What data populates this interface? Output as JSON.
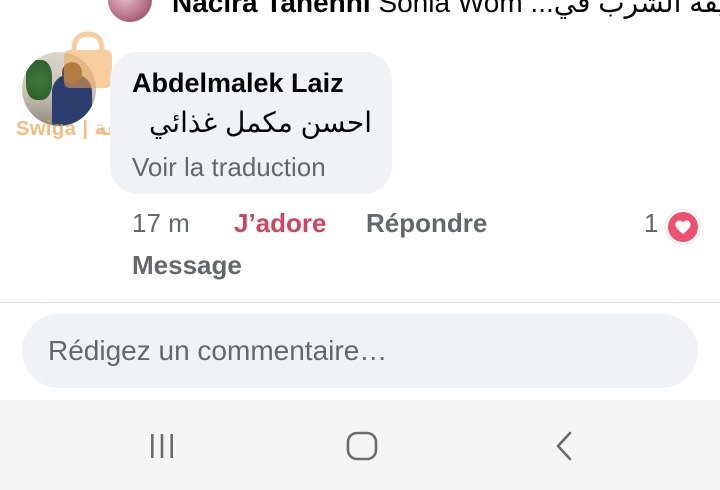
{
  "top_reply": {
    "author": "Nacira Tahenni",
    "rest": "Sonia Wom ...طريقة الشرب في"
  },
  "watermark": {
    "text": "Swiga | سويقة"
  },
  "comment": {
    "author": "Abdelmalek Laiz",
    "text": "احسن مكمل غذائي",
    "translate_label": "Voir la traduction",
    "time": "17 m",
    "like_label": "J’adore",
    "reply_label": "Répondre",
    "message_label": "Message",
    "reaction_count": "1",
    "reaction_icon": "heart-icon"
  },
  "composer": {
    "placeholder": "Rédigez un commentaire…"
  },
  "colors": {
    "like": "#d2445b",
    "heart": "#f0506e",
    "bubble": "#f0f2f5",
    "secondary_text": "#65676b"
  },
  "navbar": {
    "icons": [
      "recent-apps-icon",
      "home-icon",
      "back-icon"
    ]
  }
}
